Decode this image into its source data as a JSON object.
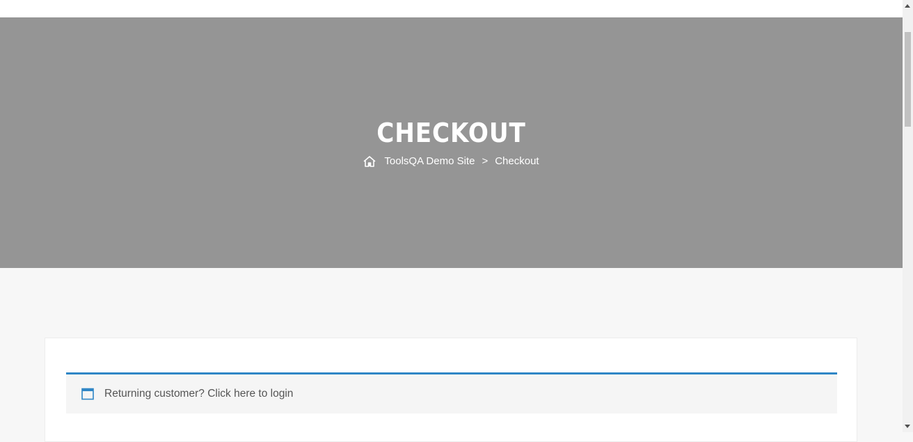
{
  "header": {
    "title": "CHECKOUT",
    "breadcrumb": {
      "home_icon": "home-icon",
      "site_label": "ToolsQA Demo Site",
      "separator": ">",
      "current_label": "Checkout"
    }
  },
  "notice": {
    "icon": "window-icon",
    "prefix": "Returning customer?",
    "link_label": "Click here to login"
  },
  "colors": {
    "hero_background": "#959595",
    "page_background": "#f7f7f7",
    "notice_accent": "#2f86c6"
  }
}
